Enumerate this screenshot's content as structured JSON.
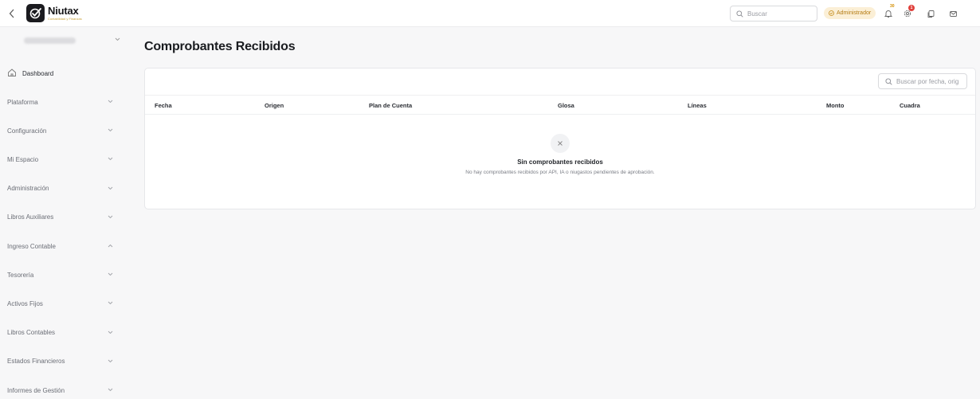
{
  "brand": {
    "name": "Niutax",
    "tagline": "Contabilidad y Finanzas"
  },
  "topbar": {
    "search_placeholder": "Buscar",
    "role_label": "Administrador",
    "notifications_count": "30",
    "settings_count": "1"
  },
  "sidebar": {
    "dashboard_label": "Dashboard",
    "items": [
      {
        "label": "Plataforma",
        "expanded": false
      },
      {
        "label": "Configuración",
        "expanded": false
      },
      {
        "label": "Mi Espacio",
        "expanded": false
      },
      {
        "label": "Administración",
        "expanded": false
      },
      {
        "label": "Libros Auxiliares",
        "expanded": false
      },
      {
        "label": "Ingreso Contable",
        "expanded": true
      },
      {
        "label": "Tesorería",
        "expanded": false
      },
      {
        "label": "Activos Fijos",
        "expanded": false
      },
      {
        "label": "Libros Contables",
        "expanded": false
      },
      {
        "label": "Estados Financieros",
        "expanded": false
      },
      {
        "label": "Informes de Gestión",
        "expanded": false
      }
    ]
  },
  "main": {
    "title": "Comprobantes Recibidos",
    "search_placeholder": "Buscar por fecha, orig",
    "columns": [
      "Fecha",
      "Origen",
      "Plan de Cuenta",
      "Glosa",
      "Líneas",
      "Monto",
      "Cuadra"
    ],
    "empty_title": "Sin comprobantes recibidos",
    "empty_description": "No hay comprobantes recibidos por API, IA o niugastos pendientes de aprobación."
  },
  "colors": {
    "accent": "#c8a13a",
    "badge_bg": "#fbefd6",
    "badge_text": "#b47b12",
    "alert_red": "#e0403b"
  }
}
